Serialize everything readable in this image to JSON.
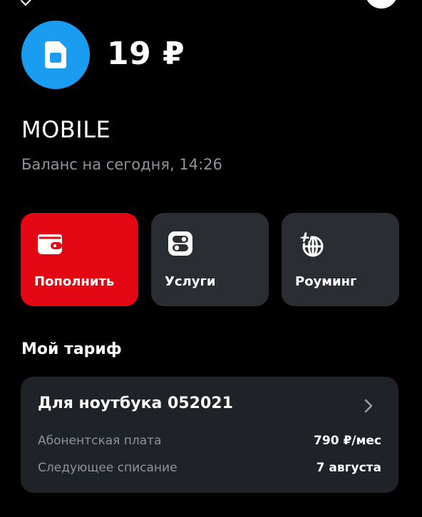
{
  "account": {
    "balance": "19 ₽",
    "name": "MOBILE",
    "balance_note": "Баланс на сегодня, 14:26"
  },
  "actions": [
    {
      "label": "Пополнить",
      "icon": "wallet-icon",
      "color": "#e30613"
    },
    {
      "label": "Услуги",
      "icon": "toggles-icon",
      "color": "#2a2d31"
    },
    {
      "label": "Роуминг",
      "icon": "globe-plane-icon",
      "color": "#2a2d31"
    }
  ],
  "tariff_section": {
    "title": "Мой тариф",
    "name": "Для ноутбука 052021",
    "rows": [
      {
        "label": "Абонентская плата",
        "value": "790 ₽/мес"
      },
      {
        "label": "Следующее списание",
        "value": "7 августа"
      }
    ]
  },
  "colors": {
    "accent_blue": "#1a9cf0",
    "accent_red": "#e30613",
    "muted_text": "#8e949b",
    "card_bg": "#1f2226"
  }
}
